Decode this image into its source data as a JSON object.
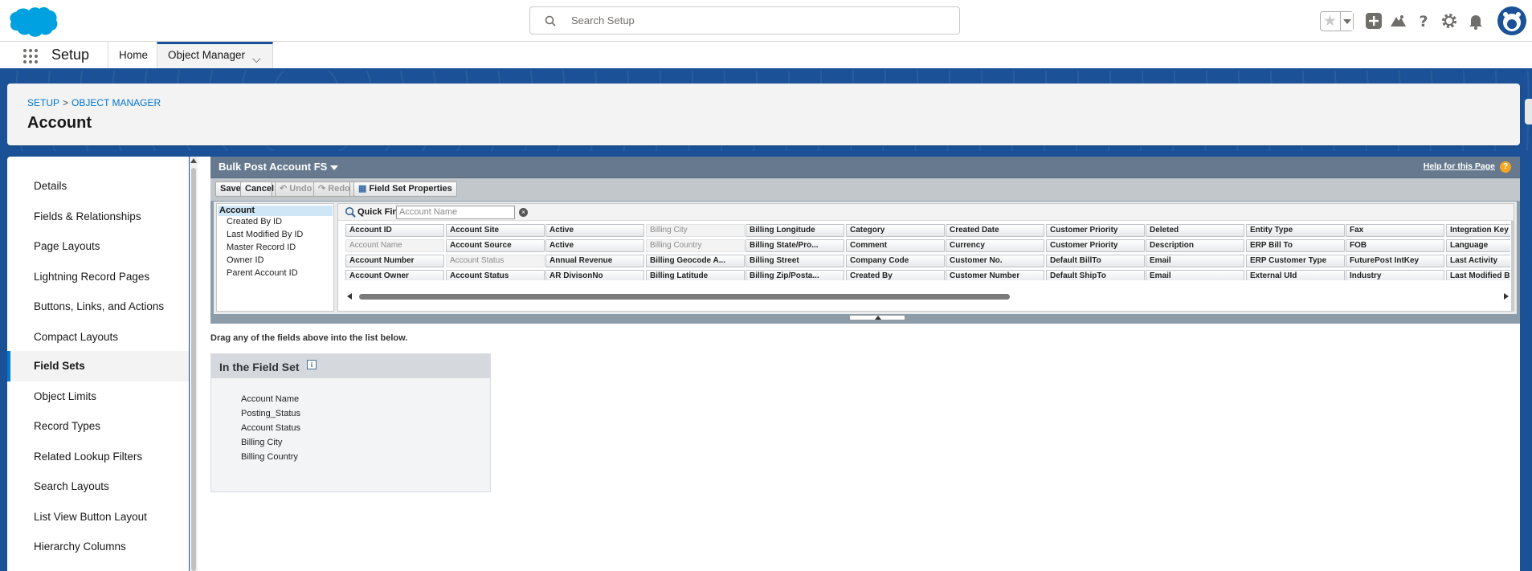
{
  "header": {
    "search_placeholder": "Search Setup",
    "icons": [
      "salesforce-cloud-logo",
      "favorites-star-icon",
      "add-icon",
      "trailhead-icon",
      "help-icon",
      "gear-icon",
      "bell-icon",
      "avatar"
    ]
  },
  "nav": {
    "app_name": "Setup",
    "tabs": [
      {
        "label": "Home"
      },
      {
        "label": "Object Manager"
      }
    ]
  },
  "page_header": {
    "breadcrumb": [
      "SETUP",
      "OBJECT MANAGER"
    ],
    "breadcrumb_sep": ">",
    "title": "Account"
  },
  "sidebar": {
    "items": [
      {
        "label": "Details"
      },
      {
        "label": "Fields & Relationships"
      },
      {
        "label": "Page Layouts"
      },
      {
        "label": "Lightning Record Pages"
      },
      {
        "label": "Buttons, Links, and Actions"
      },
      {
        "label": "Compact Layouts"
      },
      {
        "label": "Field Sets"
      },
      {
        "label": "Object Limits"
      },
      {
        "label": "Record Types"
      },
      {
        "label": "Related Lookup Filters"
      },
      {
        "label": "Search Layouts"
      },
      {
        "label": "List View Button Layout"
      },
      {
        "label": "Hierarchy Columns"
      }
    ],
    "active_index": 6
  },
  "field_set": {
    "title": "Bulk Post Account FS",
    "help_link": "Help for this Page",
    "toolbar": {
      "save": "Save",
      "cancel": "Cancel",
      "undo": "Undo",
      "redo": "Redo",
      "properties": "Field Set Properties"
    },
    "tree": {
      "root": "Account",
      "children": [
        "Created By ID",
        "Last Modified By ID",
        "Master Record ID",
        "Owner ID",
        "Parent Account ID"
      ]
    },
    "quick_find": {
      "label": "Quick Find",
      "placeholder": "Account Name"
    },
    "columns": [
      [
        "Account ID",
        "Account Name",
        "Account Number",
        "Account Owner"
      ],
      [
        "Account Site",
        "Account Source",
        "Account Status",
        "Account Status"
      ],
      [
        "Active",
        "Active",
        "Annual Revenue",
        "AR DivisonNo"
      ],
      [
        "Billing City",
        "Billing Country",
        "Billing Geocode A...",
        "Billing Latitude"
      ],
      [
        "Billing Longitude",
        "Billing State/Pro...",
        "Billing Street",
        "Billing Zip/Posta..."
      ],
      [
        "Category",
        "Comment",
        "Company Code",
        "Created By"
      ],
      [
        "Created Date",
        "Currency",
        "Customer No.",
        "Customer Number"
      ],
      [
        "Customer Priority",
        "Customer Priority",
        "Default BillTo",
        "Default ShipTo"
      ],
      [
        "Deleted",
        "Description",
        "Email",
        "Email"
      ],
      [
        "Entity Type",
        "ERP Bill To",
        "ERP Customer Type",
        "External UId"
      ],
      [
        "Fax",
        "FOB",
        "FuturePost IntKey",
        "Industry"
      ],
      [
        "Integration Key",
        "Language",
        "Last Activity",
        "Last Modified By"
      ]
    ],
    "used_fields": [
      [
        0,
        1
      ],
      [
        1,
        2
      ],
      [
        3,
        0
      ],
      [
        3,
        1
      ]
    ],
    "drag_hint": "Drag any of the fields above into the list below.",
    "in_set": {
      "title": "In the Field Set",
      "info": "i",
      "items": [
        "Account Name",
        "Posting_Status",
        "Account Status",
        "Billing City",
        "Billing Country"
      ]
    }
  }
}
